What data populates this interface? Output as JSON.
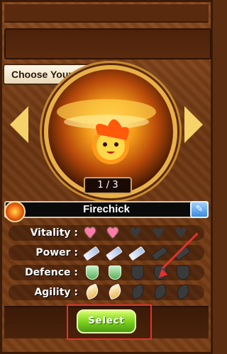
{
  "header": {
    "title": "Choose Your Monster"
  },
  "carousel": {
    "counter": "1 / 3"
  },
  "monster": {
    "name": "Firechick"
  },
  "stats": [
    {
      "label": "Vitality :",
      "type": "heart",
      "value": 2,
      "max": 5
    },
    {
      "label": "Power :",
      "type": "sword",
      "value": 3,
      "max": 5
    },
    {
      "label": "Defence :",
      "type": "shield",
      "value": 2,
      "max": 5
    },
    {
      "label": "Agility :",
      "type": "wing",
      "value": 2,
      "max": 5
    }
  ],
  "actions": {
    "select_label": "Select"
  },
  "colors": {
    "accent": "#7ed320",
    "highlight": "#e8302a",
    "frame": "#6b3612"
  }
}
